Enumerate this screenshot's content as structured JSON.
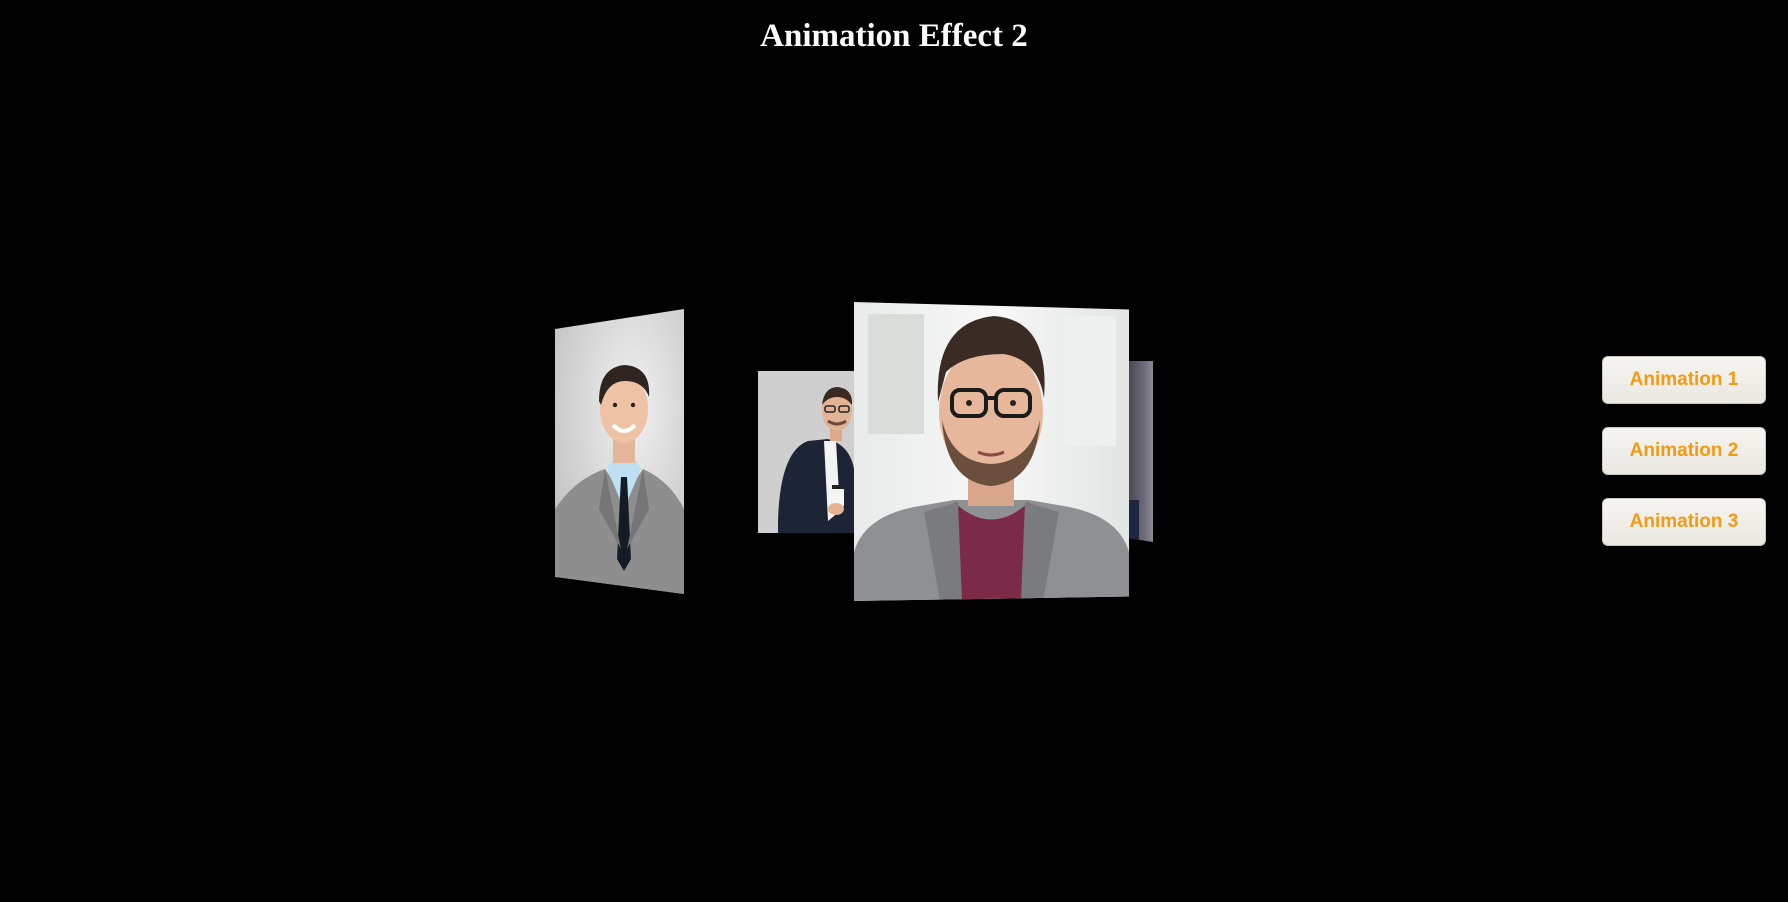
{
  "page": {
    "title": "Animation Effect 2",
    "background": "#000000"
  },
  "carousel": {
    "cards": [
      {
        "name": "photo-man-grey-suit-smiling"
      },
      {
        "name": "photo-man-glasses-coffee-cup"
      },
      {
        "name": "photo-man-glasses-beard-front"
      },
      {
        "name": "photo-card-edge"
      }
    ]
  },
  "controls": {
    "buttons": [
      {
        "label": "Animation 1"
      },
      {
        "label": "Animation 2"
      },
      {
        "label": "Animation 3"
      }
    ],
    "label_color": "#f39a11"
  }
}
